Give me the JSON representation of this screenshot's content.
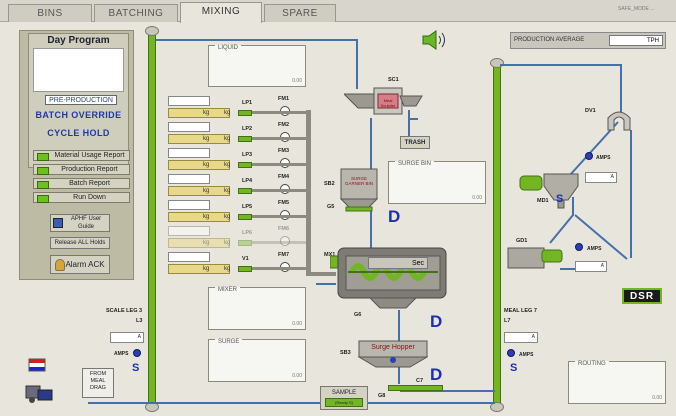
{
  "tabs": [
    {
      "label": "BINS"
    },
    {
      "label": "BATCHING"
    },
    {
      "label": "MIXING"
    },
    {
      "label": "SPARE"
    }
  ],
  "top_right_small": "SAFE_MODE ...",
  "day_program": {
    "title": "Day Program",
    "pre_production": "PRE-PRODUCTION",
    "batch_override": "BATCH OVERRIDE",
    "cycle_hold": "CYCLE HOLD",
    "reports": [
      "Material Usage Report",
      "Production Report",
      "Batch Report",
      "Run Down"
    ]
  },
  "buttons": {
    "user_guide": "APHF User Guide",
    "release_holds": "Release ALL Holds",
    "alarm_ack": "Alarm ACK",
    "from_meal_drag": "FROM MEAL DRAG",
    "sample": "SAMPLE",
    "sample_sub": "(Ready S)"
  },
  "production_average": {
    "label": "PRODUCTION AVERAGE",
    "unit": "TPH"
  },
  "panels": {
    "liquid": "LIQUID",
    "surge_bin": "SURGE BIN",
    "mixer": "MIXER",
    "surge": "SURGE",
    "routing": "ROUTING"
  },
  "panel_small": "0.00",
  "liquids": [
    {
      "lp": "LP1",
      "fm": "FM1",
      "unit": "kg"
    },
    {
      "lp": "LP2",
      "fm": "FM2",
      "unit": "kg"
    },
    {
      "lp": "LP3",
      "fm": "FM3",
      "unit": "kg"
    },
    {
      "lp": "LP4",
      "fm": "FM4",
      "unit": "kg"
    },
    {
      "lp": "LP5",
      "fm": "FM5",
      "unit": "kg"
    },
    {
      "lp": "LP6",
      "fm": "FM6",
      "unit": "kg"
    },
    {
      "lp": "V1",
      "fm": "FM7",
      "unit": "kg"
    }
  ],
  "equipment": {
    "sc1": "SC1",
    "meal_sculpter": "Meal Sculpter",
    "trash": "TRASH",
    "sb2": "SB2",
    "surge_garner": "SURGE GARNER BIN",
    "g5": "G5",
    "mx1": "MX1",
    "mixer_unit": "Sec",
    "g6": "G6",
    "sb3": "SB3",
    "surge_hopper": "Surge Hopper",
    "c7": "C7",
    "g8": "G8",
    "dv1": "DV1",
    "md1": "MD1",
    "gd1": "GD1",
    "dsr": "DSR",
    "scale_leg": "SCALE LEG 3",
    "l3": "L3",
    "meal_leg": "MEAL LEG 7",
    "l7": "L7",
    "amps": "AMPS",
    "a": "A",
    "d": "D",
    "s": "S"
  },
  "colors": {
    "pipe": "#4670a9",
    "green": "#74b524",
    "bg": "#e8e6dc",
    "accent_blue": "#1c2fb0"
  }
}
